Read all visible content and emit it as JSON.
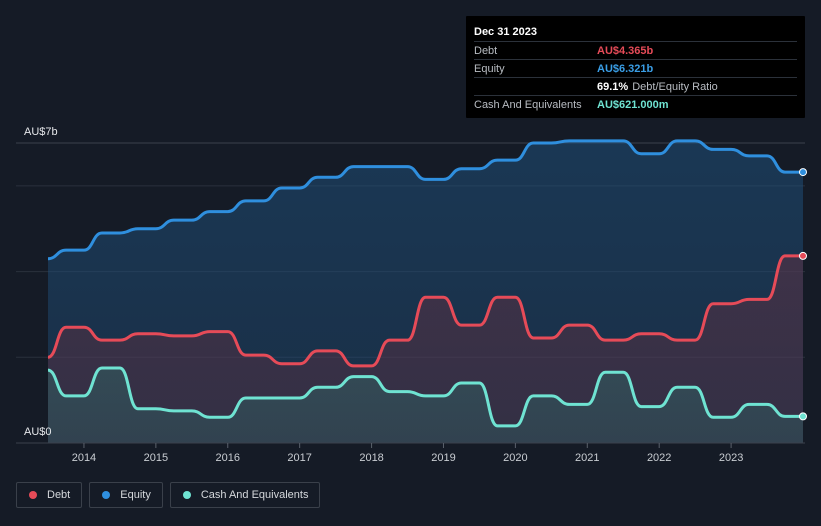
{
  "tooltip": {
    "date": "Dec 31 2023",
    "debt_label": "Debt",
    "debt_value": "AU$4.365b",
    "equity_label": "Equity",
    "equity_value": "AU$6.321b",
    "ratio_value": "69.1%",
    "ratio_label": "Debt/Equity Ratio",
    "cash_label": "Cash And Equivalents",
    "cash_value": "AU$621.000m"
  },
  "legend": {
    "debt": "Debt",
    "equity": "Equity",
    "cash": "Cash And Equivalents"
  },
  "colors": {
    "background": "#151b26",
    "debt": "#e64b58",
    "equity": "#2f8fde",
    "cash": "#6fe3d2"
  },
  "chart_data": {
    "type": "area",
    "y_unit": "AU$ billions",
    "ytick_labels": [
      "AU$0",
      "AU$7b"
    ],
    "ylim": [
      0,
      7
    ],
    "xlim": [
      2013.5,
      2024.0
    ],
    "xtick_labels": [
      "2014",
      "2015",
      "2016",
      "2017",
      "2018",
      "2019",
      "2020",
      "2021",
      "2022",
      "2023"
    ],
    "xtick_values": [
      2014,
      2015,
      2016,
      2017,
      2018,
      2019,
      2020,
      2021,
      2022,
      2023
    ],
    "grid": true,
    "legend_position": "bottom-left",
    "series": [
      {
        "name": "Equity",
        "key": "equity",
        "x": [
          2013.5,
          2013.75,
          2014.0,
          2014.25,
          2014.5,
          2014.75,
          2015.0,
          2015.25,
          2015.5,
          2015.75,
          2016.0,
          2016.25,
          2016.5,
          2016.75,
          2017.0,
          2017.25,
          2017.5,
          2017.75,
          2018.0,
          2018.25,
          2018.5,
          2018.75,
          2019.0,
          2019.25,
          2019.5,
          2019.75,
          2020.0,
          2020.25,
          2020.5,
          2020.75,
          2021.0,
          2021.25,
          2021.5,
          2021.75,
          2022.0,
          2022.25,
          2022.5,
          2022.75,
          2023.0,
          2023.25,
          2023.5,
          2023.75,
          2024.0
        ],
        "values": [
          4.3,
          4.5,
          4.5,
          4.9,
          4.9,
          5.0,
          5.0,
          5.2,
          5.2,
          5.4,
          5.4,
          5.65,
          5.65,
          5.95,
          5.95,
          6.2,
          6.2,
          6.45,
          6.45,
          6.45,
          6.45,
          6.15,
          6.15,
          6.4,
          6.4,
          6.6,
          6.6,
          7.0,
          7.0,
          7.05,
          7.05,
          7.05,
          7.05,
          6.75,
          6.75,
          7.05,
          7.05,
          6.85,
          6.85,
          6.7,
          6.7,
          6.321,
          6.321
        ]
      },
      {
        "name": "Debt",
        "key": "debt",
        "x": [
          2013.5,
          2013.75,
          2014.0,
          2014.25,
          2014.5,
          2014.75,
          2015.0,
          2015.25,
          2015.5,
          2015.75,
          2016.0,
          2016.25,
          2016.5,
          2016.75,
          2017.0,
          2017.25,
          2017.5,
          2017.75,
          2018.0,
          2018.25,
          2018.5,
          2018.75,
          2019.0,
          2019.25,
          2019.5,
          2019.75,
          2020.0,
          2020.25,
          2020.5,
          2020.75,
          2021.0,
          2021.25,
          2021.5,
          2021.75,
          2022.0,
          2022.25,
          2022.5,
          2022.75,
          2023.0,
          2023.25,
          2023.5,
          2023.75,
          2024.0
        ],
        "values": [
          2.0,
          2.7,
          2.7,
          2.4,
          2.4,
          2.55,
          2.55,
          2.5,
          2.5,
          2.6,
          2.6,
          2.05,
          2.05,
          1.85,
          1.85,
          2.15,
          2.15,
          1.8,
          1.8,
          2.4,
          2.4,
          3.4,
          3.4,
          2.75,
          2.75,
          3.4,
          3.4,
          2.45,
          2.45,
          2.75,
          2.75,
          2.4,
          2.4,
          2.55,
          2.55,
          2.4,
          2.4,
          3.25,
          3.25,
          3.35,
          3.35,
          4.365,
          4.365
        ]
      },
      {
        "name": "Cash And Equivalents",
        "key": "cash",
        "x": [
          2013.5,
          2013.75,
          2014.0,
          2014.25,
          2014.5,
          2014.75,
          2015.0,
          2015.25,
          2015.5,
          2015.75,
          2016.0,
          2016.25,
          2016.5,
          2016.75,
          2017.0,
          2017.25,
          2017.5,
          2017.75,
          2018.0,
          2018.25,
          2018.5,
          2018.75,
          2019.0,
          2019.25,
          2019.5,
          2019.75,
          2020.0,
          2020.25,
          2020.5,
          2020.75,
          2021.0,
          2021.25,
          2021.5,
          2021.75,
          2022.0,
          2022.25,
          2022.5,
          2022.75,
          2023.0,
          2023.25,
          2023.5,
          2023.75,
          2024.0
        ],
        "values": [
          1.7,
          1.1,
          1.1,
          1.75,
          1.75,
          0.8,
          0.8,
          0.75,
          0.75,
          0.6,
          0.6,
          1.05,
          1.05,
          1.05,
          1.05,
          1.3,
          1.3,
          1.55,
          1.55,
          1.2,
          1.2,
          1.1,
          1.1,
          1.4,
          1.4,
          0.4,
          0.4,
          1.1,
          1.1,
          0.9,
          0.9,
          1.65,
          1.65,
          0.85,
          0.85,
          1.3,
          1.3,
          0.6,
          0.6,
          0.9,
          0.9,
          0.621,
          0.621
        ]
      }
    ]
  }
}
